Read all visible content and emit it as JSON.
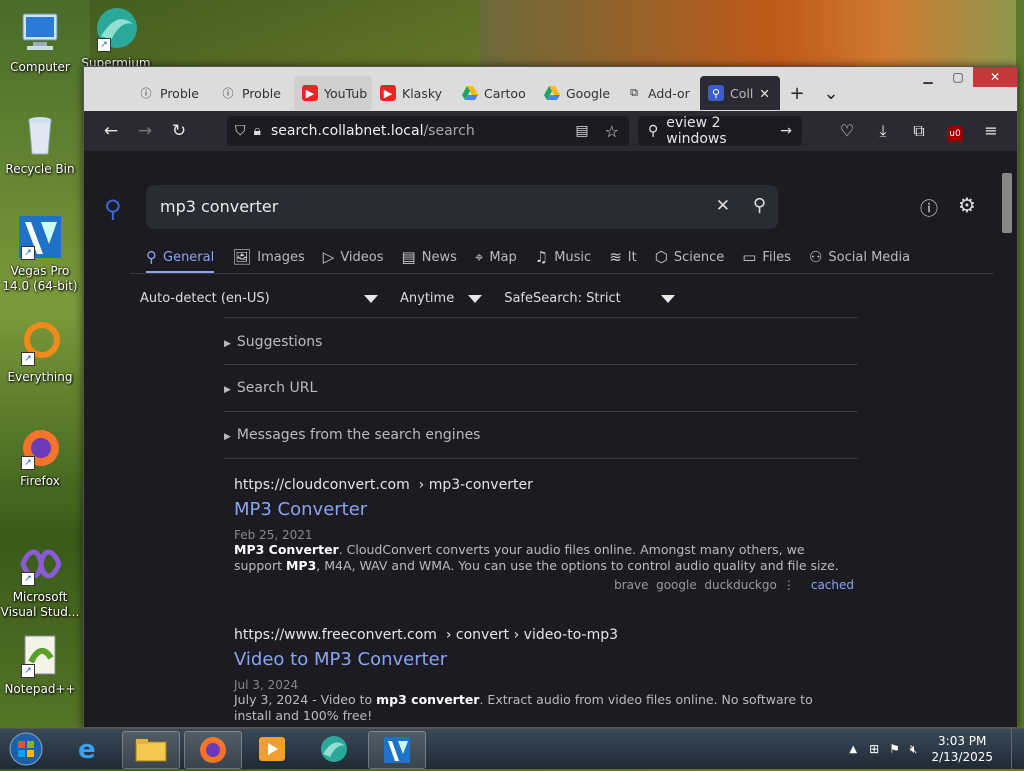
{
  "desktop": {
    "icons": [
      {
        "label": "Computer"
      },
      {
        "label": "Supermium"
      },
      {
        "label": "Recycle Bin"
      },
      {
        "label": "Vegas Pro 14.0 (64-bit)"
      },
      {
        "label": "Everything"
      },
      {
        "label": "Firefox"
      },
      {
        "label": "Microsoft Visual Stud..."
      },
      {
        "label": "Notepad++"
      }
    ]
  },
  "browser": {
    "tabs": [
      {
        "label": "Proble",
        "icon": "info-icon"
      },
      {
        "label": "Proble",
        "icon": "info-icon"
      },
      {
        "label": "YouTub",
        "icon": "youtube-icon"
      },
      {
        "label": "Klasky",
        "icon": "youtube-icon"
      },
      {
        "label": "Cartoo",
        "icon": "google-drive-icon"
      },
      {
        "label": "Google",
        "icon": "google-drive-icon"
      },
      {
        "label": "Add-or",
        "icon": "puzzle-icon"
      },
      {
        "label": "Coll",
        "icon": "search-icon"
      }
    ],
    "url": {
      "host": "search.collabnet.local",
      "path": "/search"
    },
    "searchbar": {
      "text": "eview 2 windows"
    }
  },
  "page": {
    "query": "mp3 converter",
    "categories": [
      {
        "label": "General",
        "icon": "search-icon"
      },
      {
        "label": "Images",
        "icon": "image-icon"
      },
      {
        "label": "Videos",
        "icon": "play-icon"
      },
      {
        "label": "News",
        "icon": "news-icon"
      },
      {
        "label": "Map",
        "icon": "map-pin-icon"
      },
      {
        "label": "Music",
        "icon": "music-icon"
      },
      {
        "label": "It",
        "icon": "layers-icon"
      },
      {
        "label": "Science",
        "icon": "science-icon"
      },
      {
        "label": "Files",
        "icon": "files-icon"
      },
      {
        "label": "Social Media",
        "icon": "people-icon"
      }
    ],
    "filters": {
      "language": "Auto-detect (en-US)",
      "time": "Anytime",
      "safesearch": "SafeSearch: Strict"
    },
    "folds": [
      "Suggestions",
      "Search URL",
      "Messages from the search engines"
    ],
    "results": [
      {
        "url": "https://cloudconvert.com",
        "path": "› mp3-converter",
        "title": "MP3 Converter",
        "date": "Feb 25, 2021",
        "snippet_bold": "MP3 Converter",
        "snippet_rest": ". CloudConvert converts your audio files online. Amongst many others, we support ",
        "snippet_bold2": "MP3",
        "snippet_tail": ", M4A, WAV and WMA. You can use the options to control audio quality and file size.",
        "engines": "brave  google  duckduckgo",
        "cached": "cached"
      },
      {
        "url": "https://www.freeconvert.com",
        "path": "› convert › video-to-mp3",
        "title": "Video to MP3 Converter",
        "date": "Jul 3, 2024",
        "snippet_pre": "July 3, 2024 - Video to ",
        "snippet_bold": "mp3 converter",
        "snippet_tail": ". Extract audio from video files online. No software to install and 100% free!"
      }
    ]
  },
  "taskbar": {
    "time": "3:03 PM",
    "date": "2/13/2025"
  }
}
